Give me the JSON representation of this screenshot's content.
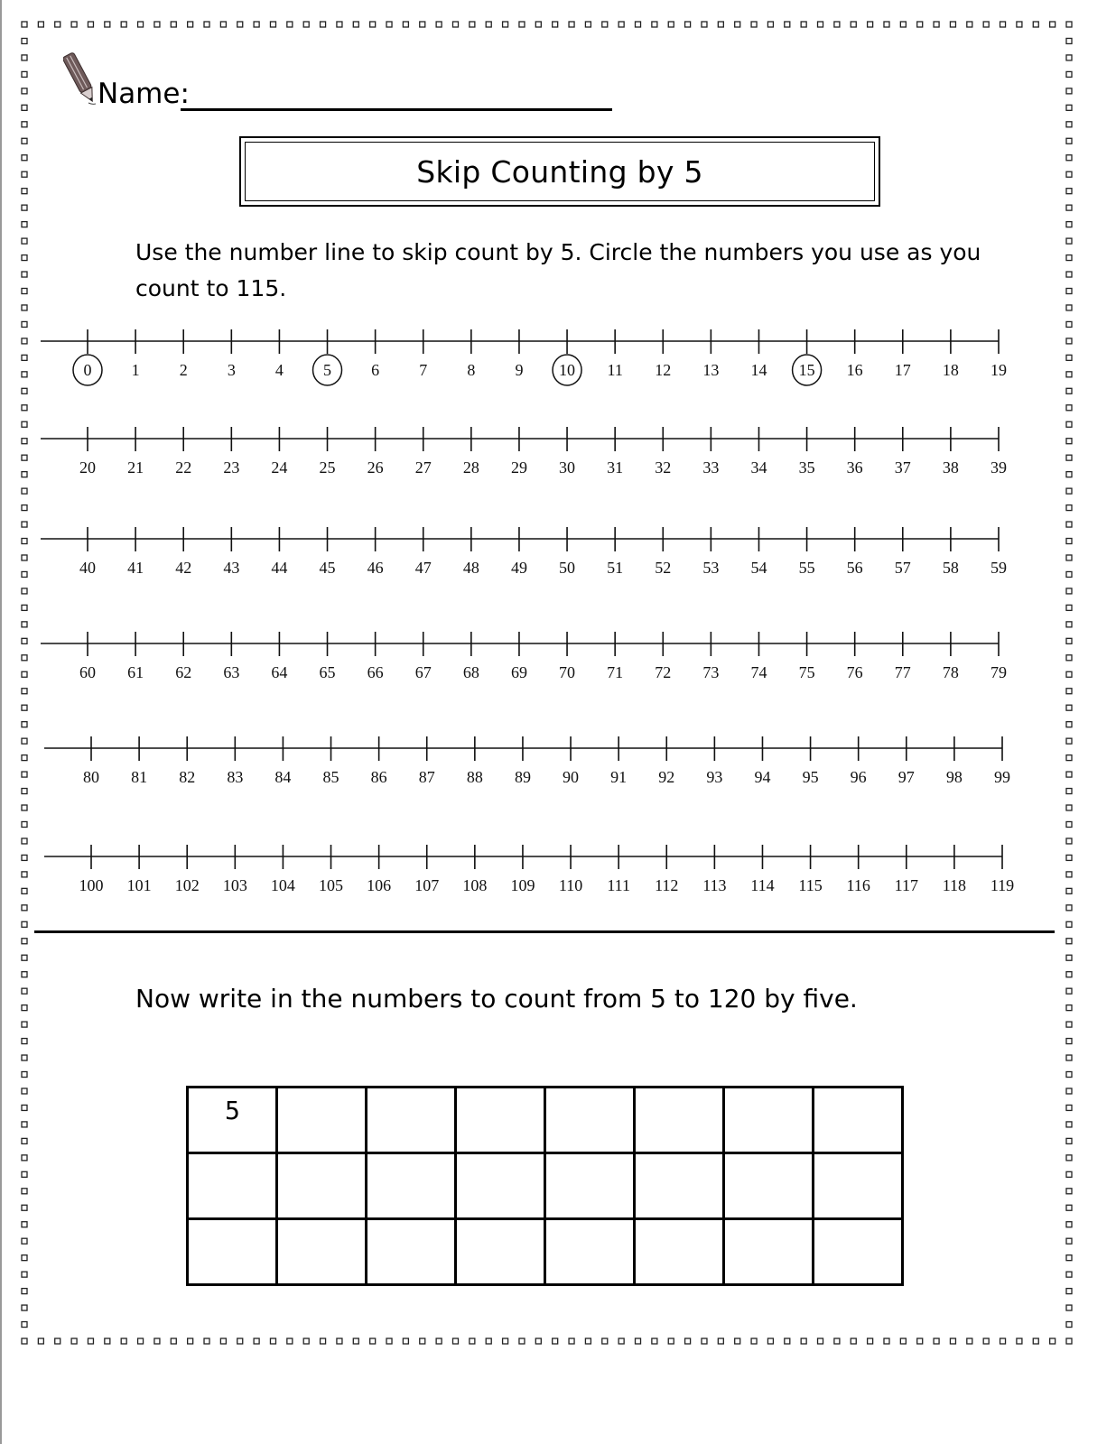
{
  "page": {
    "name_label": "Name:",
    "title": "Skip Counting by 5",
    "instructions": "Use the number line to skip count by 5.  Circle the numbers you use as you count to 115.",
    "instructions_2": "Now write in the numbers to count from 5 to 120 by five.",
    "icons": {
      "pencil": "pencil-icon"
    }
  },
  "number_lines": [
    {
      "start": 0,
      "labels": [
        "0",
        "1",
        "2",
        "3",
        "4",
        "5",
        "6",
        "7",
        "8",
        "9",
        "10",
        "11",
        "12",
        "13",
        "14",
        "15",
        "16",
        "17",
        "18",
        "19"
      ],
      "circled": [
        "0",
        "5",
        "10",
        "15"
      ]
    },
    {
      "start": 20,
      "labels": [
        "20",
        "21",
        "22",
        "23",
        "24",
        "25",
        "26",
        "27",
        "28",
        "29",
        "30",
        "31",
        "32",
        "33",
        "34",
        "35",
        "36",
        "37",
        "38",
        "39"
      ],
      "circled": []
    },
    {
      "start": 40,
      "labels": [
        "40",
        "41",
        "42",
        "43",
        "44",
        "45",
        "46",
        "47",
        "48",
        "49",
        "50",
        "51",
        "52",
        "53",
        "54",
        "55",
        "56",
        "57",
        "58",
        "59"
      ],
      "circled": []
    },
    {
      "start": 60,
      "labels": [
        "60",
        "61",
        "62",
        "63",
        "64",
        "65",
        "66",
        "67",
        "68",
        "69",
        "70",
        "71",
        "72",
        "73",
        "74",
        "75",
        "76",
        "77",
        "78",
        "79"
      ],
      "circled": []
    },
    {
      "start": 80,
      "labels": [
        "80",
        "81",
        "82",
        "83",
        "84",
        "85",
        "86",
        "87",
        "88",
        "89",
        "90",
        "91",
        "92",
        "93",
        "94",
        "95",
        "96",
        "97",
        "98",
        "99"
      ],
      "circled": []
    },
    {
      "start": 100,
      "labels": [
        "100",
        "101",
        "102",
        "103",
        "104",
        "105",
        "106",
        "107",
        "108",
        "109",
        "110",
        "111",
        "112",
        "113",
        "114",
        "115",
        "116",
        "117",
        "118",
        "119"
      ],
      "circled": []
    }
  ],
  "answer_grid": {
    "rows": [
      [
        "5",
        "",
        "",
        "",
        "",
        "",
        "",
        ""
      ],
      [
        "",
        "",
        "",
        "",
        "",
        "",
        "",
        ""
      ],
      [
        "",
        "",
        "",
        "",
        "",
        "",
        "",
        ""
      ]
    ]
  }
}
